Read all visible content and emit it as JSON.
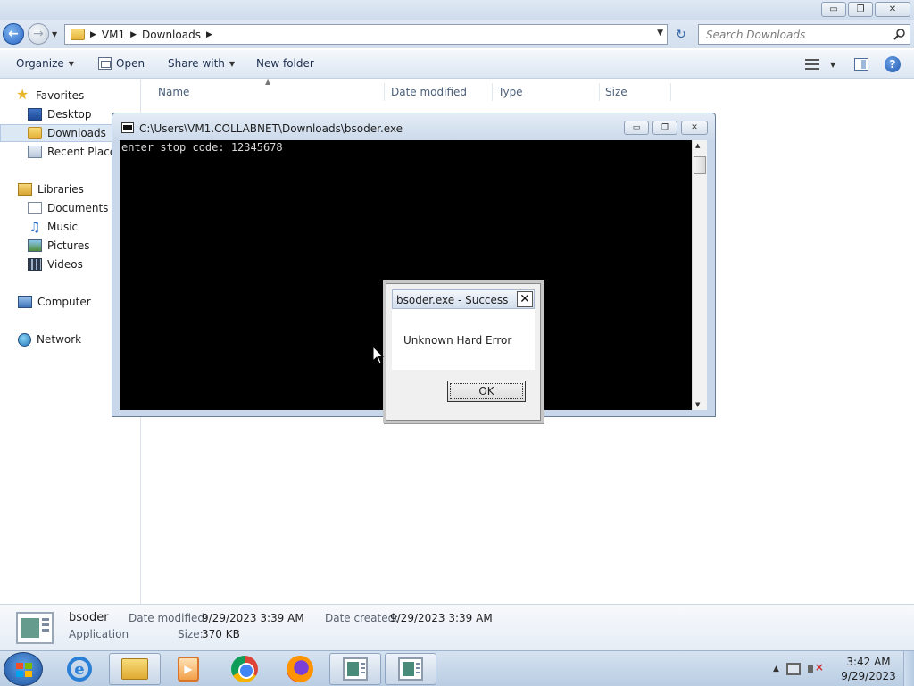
{
  "window": {
    "minimize": "▭",
    "restore": "❐",
    "close": "✕"
  },
  "address": {
    "segments": [
      "VM1",
      "Downloads"
    ],
    "search_placeholder": "Search Downloads"
  },
  "toolbar": {
    "organize": "Organize",
    "open": "Open",
    "share_with": "Share with",
    "new_folder": "New folder"
  },
  "nav": {
    "favorites": "Favorites",
    "desktop": "Desktop",
    "downloads": "Downloads",
    "recent_places": "Recent Places",
    "libraries": "Libraries",
    "documents": "Documents",
    "music": "Music",
    "pictures": "Pictures",
    "videos": "Videos",
    "computer": "Computer",
    "network": "Network"
  },
  "columns": {
    "name": "Name",
    "date_modified": "Date modified",
    "type": "Type",
    "size": "Size"
  },
  "console": {
    "title": "C:\\Users\\VM1.COLLABNET\\Downloads\\bsoder.exe",
    "output": "enter stop code: 12345678"
  },
  "msgbox": {
    "title": "bsoder.exe - Success",
    "message": "Unknown Hard Error",
    "ok": "OK",
    "close": "✕"
  },
  "details": {
    "name": "bsoder",
    "type": "Application",
    "date_modified_label": "Date modified:",
    "date_modified": "9/29/2023 3:39 AM",
    "date_created_label": "Date created:",
    "date_created": "9/29/2023 3:39 AM",
    "size_label": "Size:",
    "size": "370 KB"
  },
  "taskbar": {
    "time": "3:42 AM",
    "date": "9/29/2023"
  },
  "icons": {
    "back": "back-arrow-icon",
    "forward": "forward-arrow-icon",
    "search": "search-icon",
    "help": "help-icon"
  }
}
